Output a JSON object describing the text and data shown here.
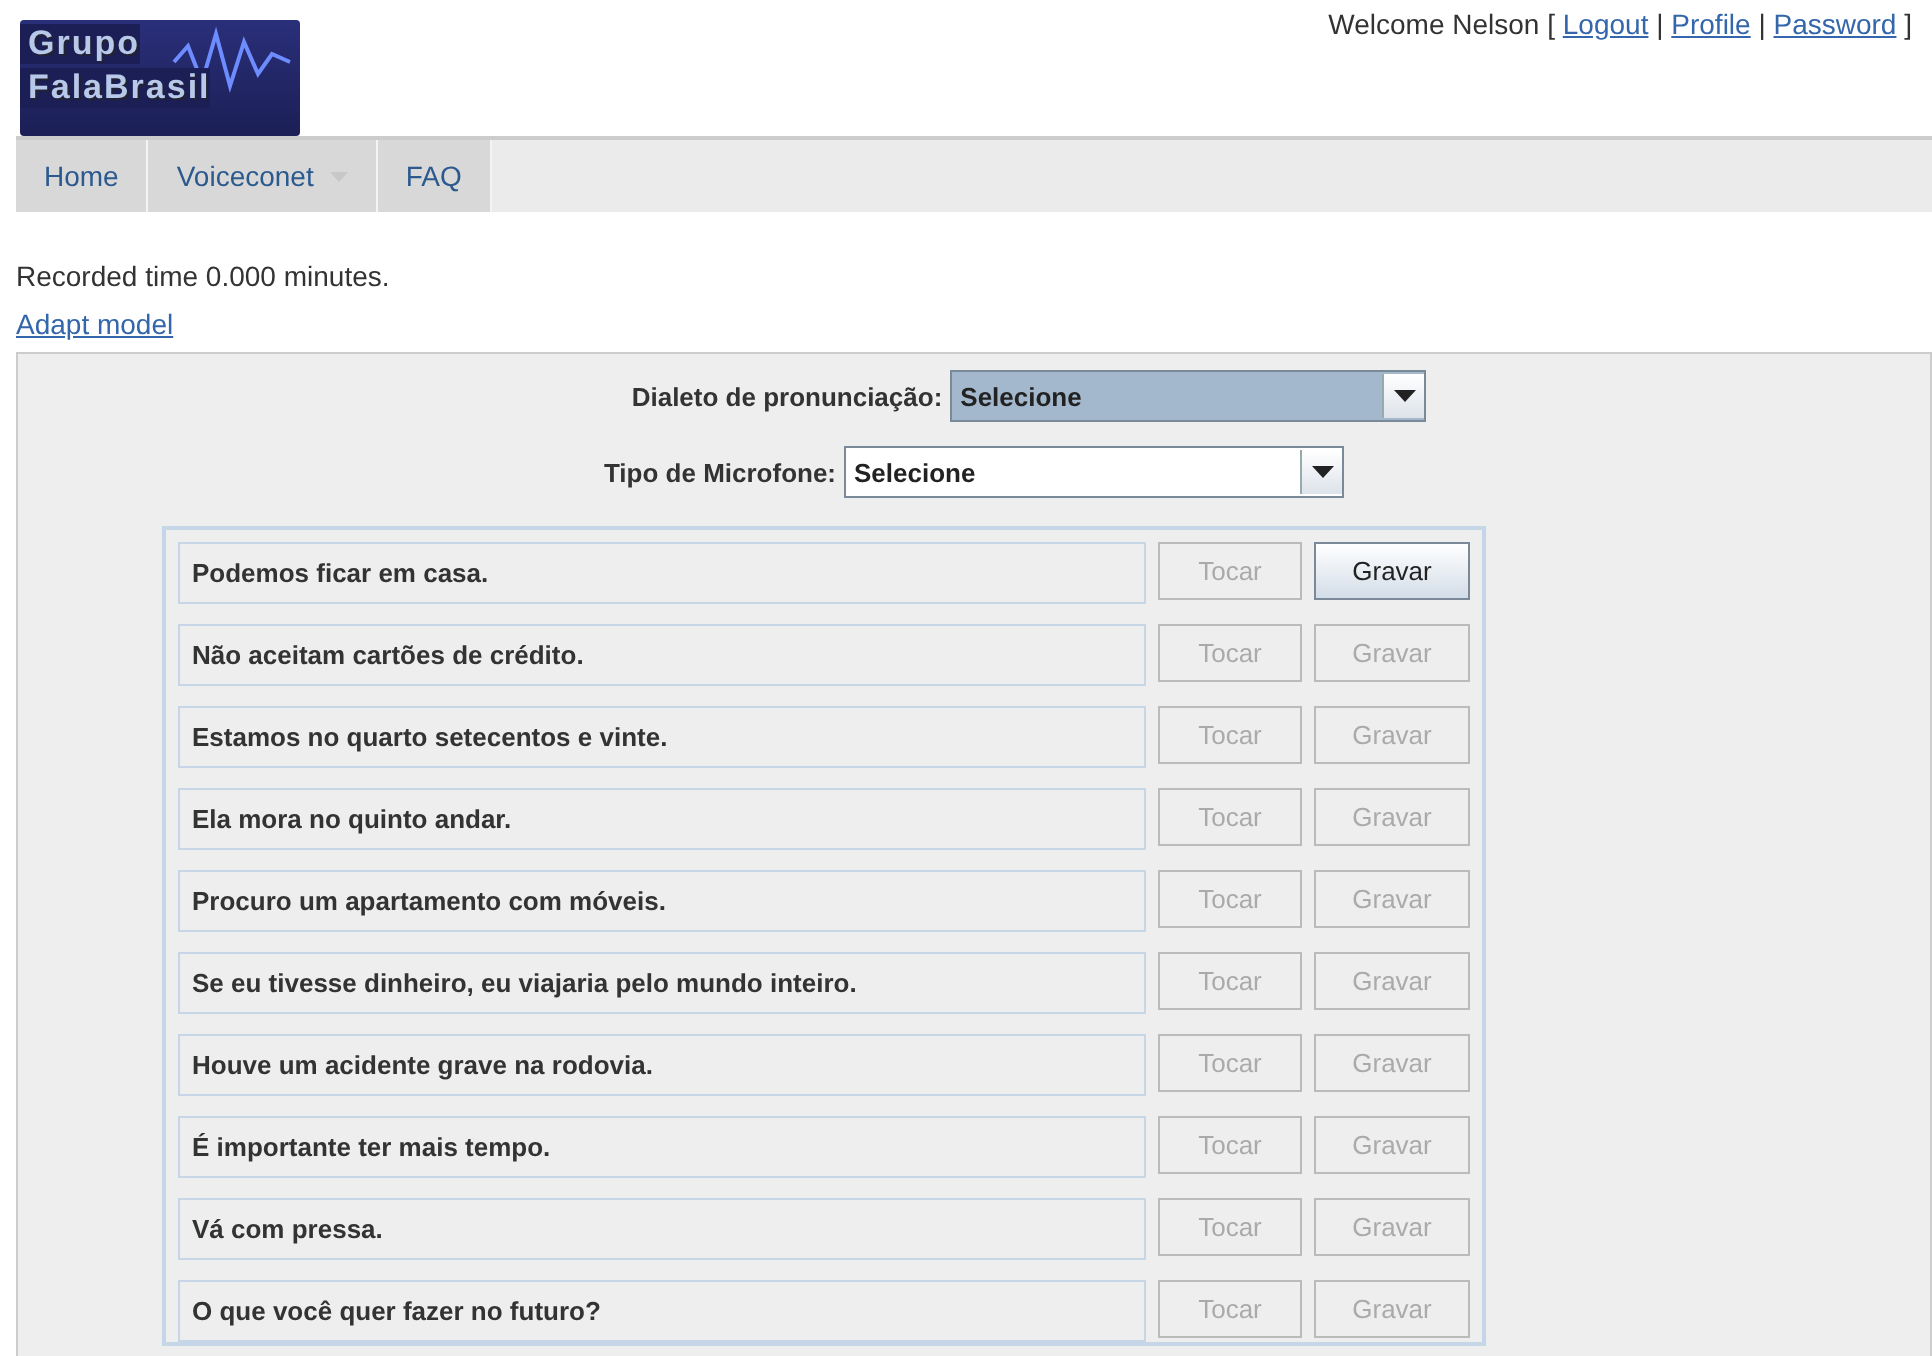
{
  "logo": {
    "line_1": "Grupo",
    "line_2": "FalaBrasil"
  },
  "user_bar": {
    "welcome": "Welcome Nelson",
    "open_bracket": "[",
    "separator": "|",
    "close_bracket": "]",
    "links": [
      "Logout",
      "Profile",
      "Password"
    ]
  },
  "nav": [
    {
      "label": "Home",
      "has_menu": false
    },
    {
      "label": "Voiceconet",
      "has_menu": true
    },
    {
      "label": "FAQ",
      "has_menu": false
    }
  ],
  "recorded_time": "Recorded time 0.000 minutes.",
  "adapt_link": "Adapt model",
  "selects": [
    {
      "label": "Dialeto de pronunciação:",
      "value": "Selecione",
      "focused": true
    },
    {
      "label": "Tipo de Microfone:",
      "value": "Selecione",
      "focused": false
    }
  ],
  "sentences": [
    {
      "text": "Podemos ficar em casa.",
      "play": {
        "label": "Tocar",
        "disabled": true
      },
      "record": {
        "label": "Gravar",
        "disabled": false
      }
    },
    {
      "text": "Não aceitam cartões de crédito.",
      "play": {
        "label": "Tocar",
        "disabled": true
      },
      "record": {
        "label": "Gravar",
        "disabled": true
      }
    },
    {
      "text": "Estamos no quarto setecentos e vinte.",
      "play": {
        "label": "Tocar",
        "disabled": true
      },
      "record": {
        "label": "Gravar",
        "disabled": true
      }
    },
    {
      "text": "Ela mora no quinto andar.",
      "play": {
        "label": "Tocar",
        "disabled": true
      },
      "record": {
        "label": "Gravar",
        "disabled": true
      }
    },
    {
      "text": "Procuro um apartamento com móveis.",
      "play": {
        "label": "Tocar",
        "disabled": true
      },
      "record": {
        "label": "Gravar",
        "disabled": true
      }
    },
    {
      "text": "Se eu tivesse dinheiro, eu viajaria pelo mundo inteiro.",
      "play": {
        "label": "Tocar",
        "disabled": true
      },
      "record": {
        "label": "Gravar",
        "disabled": true
      }
    },
    {
      "text": "Houve um acidente grave na rodovia.",
      "play": {
        "label": "Tocar",
        "disabled": true
      },
      "record": {
        "label": "Gravar",
        "disabled": true
      }
    },
    {
      "text": "É importante ter mais tempo.",
      "play": {
        "label": "Tocar",
        "disabled": true
      },
      "record": {
        "label": "Gravar",
        "disabled": true
      }
    },
    {
      "text": "Vá com pressa.",
      "play": {
        "label": "Tocar",
        "disabled": true
      },
      "record": {
        "label": "Gravar",
        "disabled": true
      }
    },
    {
      "text": "O que você quer fazer no futuro?",
      "play": {
        "label": "Tocar",
        "disabled": true
      },
      "record": {
        "label": "Gravar",
        "disabled": true
      }
    }
  ]
}
